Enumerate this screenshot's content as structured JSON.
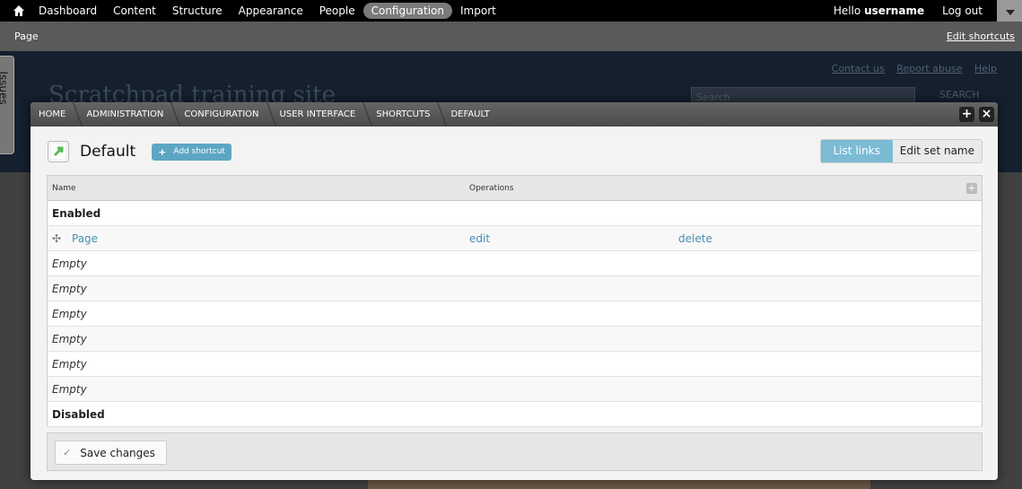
{
  "toolbar": {
    "menu": [
      "Dashboard",
      "Content",
      "Structure",
      "Appearance",
      "People",
      "Configuration",
      "Import"
    ],
    "active": "Configuration",
    "hello": "Hello",
    "username": "username",
    "logout": "Log out"
  },
  "shortcuts": {
    "current": "Page",
    "edit_label": "Edit shortcuts"
  },
  "site": {
    "name": "Scratchpad training site",
    "links": [
      "Contact us",
      "Report abuse",
      "Help"
    ],
    "search_placeholder": "Search",
    "search_button": "SEARCH",
    "issues_tab": "Issues"
  },
  "overlay": {
    "breadcrumb": [
      "HOME",
      "ADMINISTRATION",
      "CONFIGURATION",
      "USER INTERFACE",
      "SHORTCUTS",
      "DEFAULT"
    ],
    "title": "Default",
    "add_shortcut": "Add shortcut",
    "tabs": [
      "List links",
      "Edit set name"
    ],
    "table": {
      "headers": [
        "Name",
        "Operations"
      ],
      "enabled_label": "Enabled",
      "link": {
        "name": "Page",
        "edit": "edit",
        "delete": "delete"
      },
      "empty_rows": [
        "Empty",
        "Empty",
        "Empty",
        "Empty",
        "Empty",
        "Empty"
      ],
      "disabled_label": "Disabled"
    },
    "save_button": "Save changes"
  },
  "colors": {
    "accent": "#5ca6c4",
    "link": "#4a8fb0",
    "toolbar": "#000000"
  }
}
